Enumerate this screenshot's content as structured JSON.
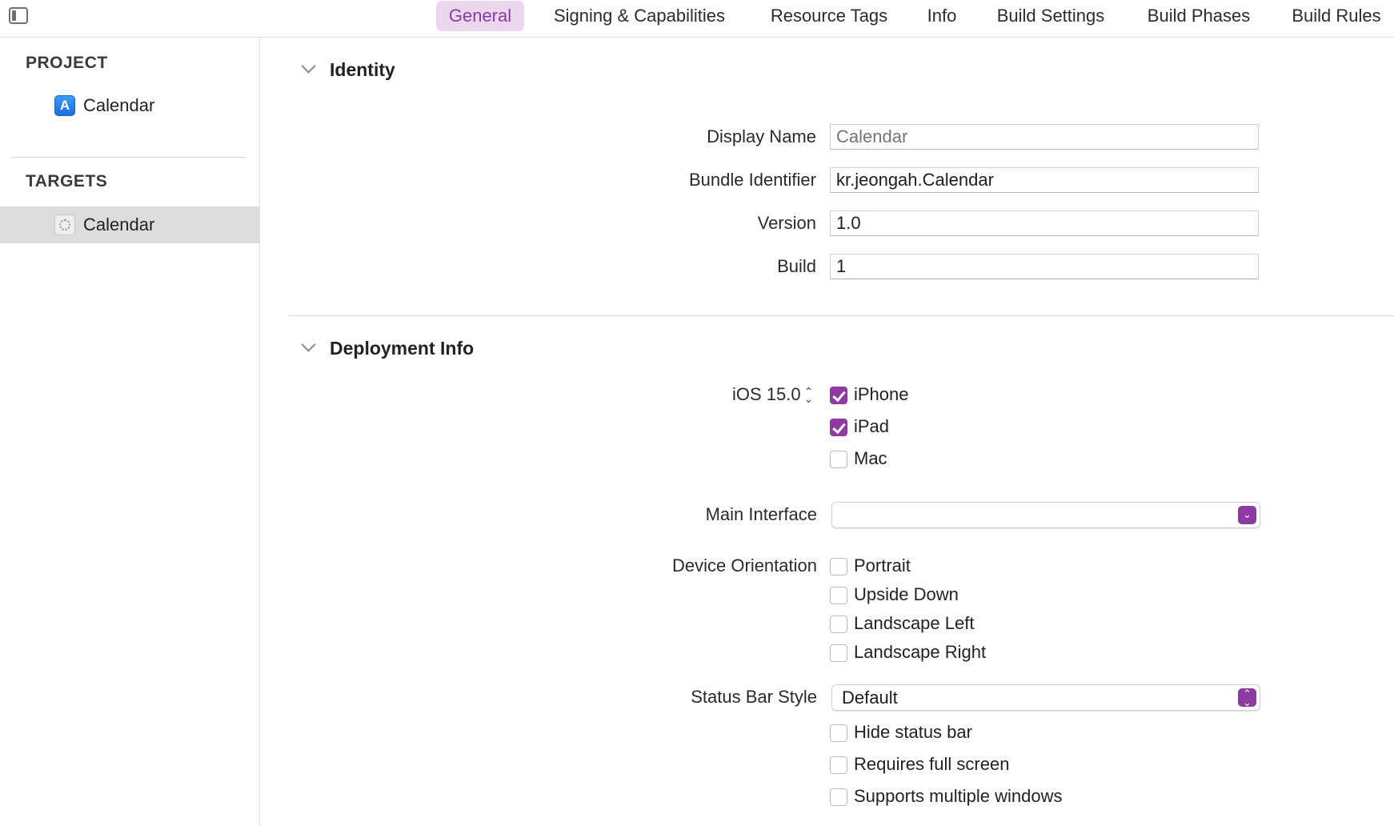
{
  "tabs": [
    {
      "label": "General",
      "active": true
    },
    {
      "label": "Signing & Capabilities",
      "active": false
    },
    {
      "label": "Resource Tags",
      "active": false
    },
    {
      "label": "Info",
      "active": false
    },
    {
      "label": "Build Settings",
      "active": false
    },
    {
      "label": "Build Phases",
      "active": false
    },
    {
      "label": "Build Rules",
      "active": false
    }
  ],
  "sidebar": {
    "project_header": "PROJECT",
    "project_item": "Calendar",
    "targets_header": "TARGETS",
    "target_item": "Calendar"
  },
  "identity": {
    "title": "Identity",
    "display_name_label": "Display Name",
    "display_name_placeholder": "Calendar",
    "bundle_id_label": "Bundle Identifier",
    "bundle_id_value": "kr.jeongah.Calendar",
    "version_label": "Version",
    "version_value": "1.0",
    "build_label": "Build",
    "build_value": "1"
  },
  "deployment": {
    "title": "Deployment Info",
    "ios_version": "iOS 15.0",
    "devices": [
      {
        "label": "iPhone",
        "checked": true
      },
      {
        "label": "iPad",
        "checked": true
      },
      {
        "label": "Mac",
        "checked": false
      }
    ],
    "main_interface_label": "Main Interface",
    "main_interface_value": "",
    "device_orientation_label": "Device Orientation",
    "orientations": [
      {
        "label": "Portrait",
        "checked": false
      },
      {
        "label": "Upside Down",
        "checked": false
      },
      {
        "label": "Landscape Left",
        "checked": false
      },
      {
        "label": "Landscape Right",
        "checked": false
      }
    ],
    "status_bar_style_label": "Status Bar Style",
    "status_bar_style_value": "Default",
    "status_options": [
      {
        "label": "Hide status bar",
        "checked": false
      },
      {
        "label": "Requires full screen",
        "checked": false
      },
      {
        "label": "Supports multiple windows",
        "checked": false
      }
    ]
  },
  "colors": {
    "accent": "#8d3aa1",
    "tab_active_bg": "#ead7ee",
    "sidebar_selected_bg": "#dcdcdc"
  },
  "icons": {
    "sidebar_toggle": "sidebar-left-icon",
    "project_icon": "xcode-app-store-icon",
    "target_icon": "app-placeholder-icon",
    "disclosure": "chevron-down-icon",
    "stepper": "up-down-chevron-icon",
    "popup_single": "chevron-down-icon",
    "popup_double": "up-down-chevron-icon"
  }
}
